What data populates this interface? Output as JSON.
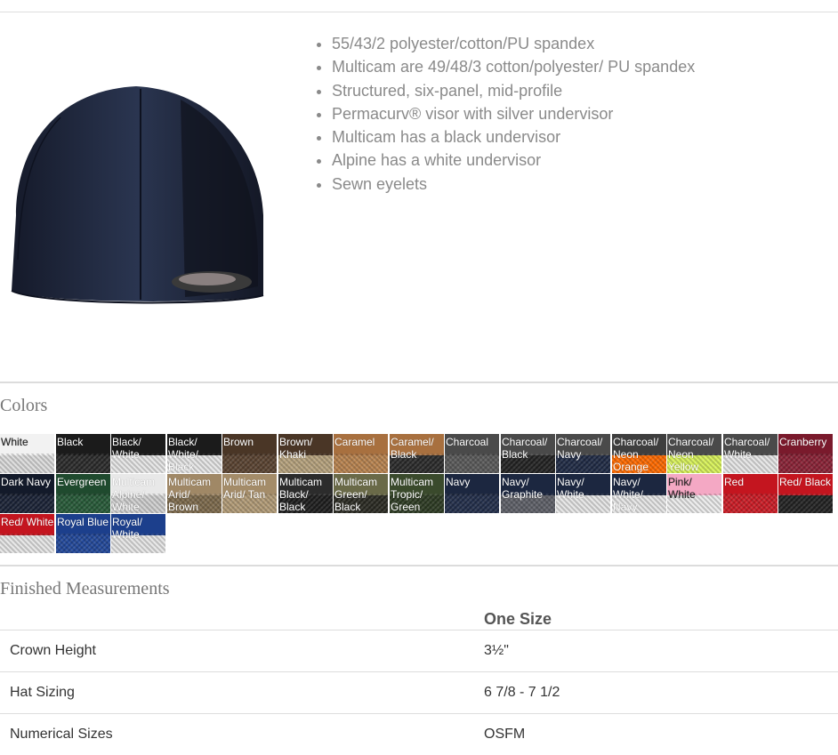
{
  "features": [
    "55/43/2 polyester/cotton/PU spandex",
    "Multicam are 49/48/3 cotton/polyester/ PU spandex",
    "Structured, six-panel, mid-profile",
    "Permacurv® visor with silver undervisor",
    "Multicam has a black undervisor",
    "Alpine has a white undervisor",
    "Sewn eyelets"
  ],
  "colors_title": "Colors",
  "colors": [
    {
      "label": "White",
      "top": "#f2f2f2",
      "bottom": "#dcdcdc",
      "dark_text": true
    },
    {
      "label": "Black",
      "top": "#1b1b1b",
      "bottom": "#2a2a2a"
    },
    {
      "label": "Black/ White",
      "top": "#1b1b1b",
      "bottom": "#e6e6e6"
    },
    {
      "label": "Black/ White/ Black",
      "top": "#1b1b1b",
      "bottom": "#e6e6e6"
    },
    {
      "label": "Brown",
      "top": "#4a3626",
      "bottom": "#5a4331"
    },
    {
      "label": "Brown/ Khaki",
      "top": "#4a3626",
      "bottom": "#b7a37e"
    },
    {
      "label": "Caramel",
      "top": "#a8703f",
      "bottom": "#b98450"
    },
    {
      "label": "Caramel/ Black",
      "top": "#a8703f",
      "bottom": "#2a2a2a"
    },
    {
      "label": "Charcoal",
      "top": "#4a4a4a",
      "bottom": "#5a5a5a"
    },
    {
      "label": "Charcoal/ Black",
      "top": "#4a4a4a",
      "bottom": "#222"
    },
    {
      "label": "Charcoal/ Navy",
      "top": "#4a4a4a",
      "bottom": "#1f2a44"
    },
    {
      "label": "Charcoal/ Neon Orange",
      "top": "#3e3e3e",
      "bottom": "#ff6a00"
    },
    {
      "label": "Charcoal/ Neon Yellow",
      "top": "#4a4a4a",
      "bottom": "#d8f25a"
    },
    {
      "label": "Charcoal/ White",
      "top": "#4a4a4a",
      "bottom": "#e6e6e6"
    },
    {
      "label": "Cranberry",
      "top": "#7a1a2c",
      "bottom": "#8a2236"
    },
    {
      "label": "Dark Navy",
      "top": "#131a2a",
      "bottom": "#1a2236"
    },
    {
      "label": "Evergreen",
      "top": "#1f4a2e",
      "bottom": "#275a38"
    },
    {
      "label": "Multicam Alpine/ White",
      "top": "#e8e8e8",
      "bottom": "#cfcfcf"
    },
    {
      "label": "Multicam Arid/ Brown",
      "top": "#a08866",
      "bottom": "#7d6a4c"
    },
    {
      "label": "Multicam Arid/ Tan",
      "top": "#a48c69",
      "bottom": "#b39c78"
    },
    {
      "label": "Multicam Black/ Black",
      "top": "#2c2c2c",
      "bottom": "#1d1d1d"
    },
    {
      "label": "Multicam Green/ Black",
      "top": "#6a6a48",
      "bottom": "#2a2a22"
    },
    {
      "label": "Multicam Tropic/ Green",
      "top": "#3a4a2c",
      "bottom": "#2c3a22"
    },
    {
      "label": "Navy",
      "top": "#1c2740",
      "bottom": "#222e4a"
    },
    {
      "label": "Navy/ Graphite",
      "top": "#1c2740",
      "bottom": "#5e6068"
    },
    {
      "label": "Navy/ White",
      "top": "#1c2740",
      "bottom": "#e6e6e6"
    },
    {
      "label": "Navy/ White/ Navy",
      "top": "#1c2740",
      "bottom": "#e6e6e6"
    },
    {
      "label": "Pink/ White",
      "top": "#f4a8c4",
      "bottom": "#ececec",
      "dark_text": true
    },
    {
      "label": "Red",
      "top": "#c4151f",
      "bottom": "#cc1c26"
    },
    {
      "label": "Red/ Black",
      "top": "#c4151f",
      "bottom": "#222"
    },
    {
      "label": "Red/ White",
      "top": "#c4151f",
      "bottom": "#e6e6e6"
    },
    {
      "label": "Royal Blue",
      "top": "#1c3f8c",
      "bottom": "#22489a"
    },
    {
      "label": "Royal/ White",
      "top": "#1c3f8c",
      "bottom": "#e6e6e6"
    }
  ],
  "measurements_title": "Finished Measurements",
  "measurements": {
    "size_header": "One Size",
    "rows": [
      {
        "label": "Crown Height",
        "value": "3½\""
      },
      {
        "label": "Hat Sizing",
        "value": "6 7/8 - 7 1/2"
      },
      {
        "label": "Numerical Sizes",
        "value": "OSFM"
      }
    ]
  }
}
